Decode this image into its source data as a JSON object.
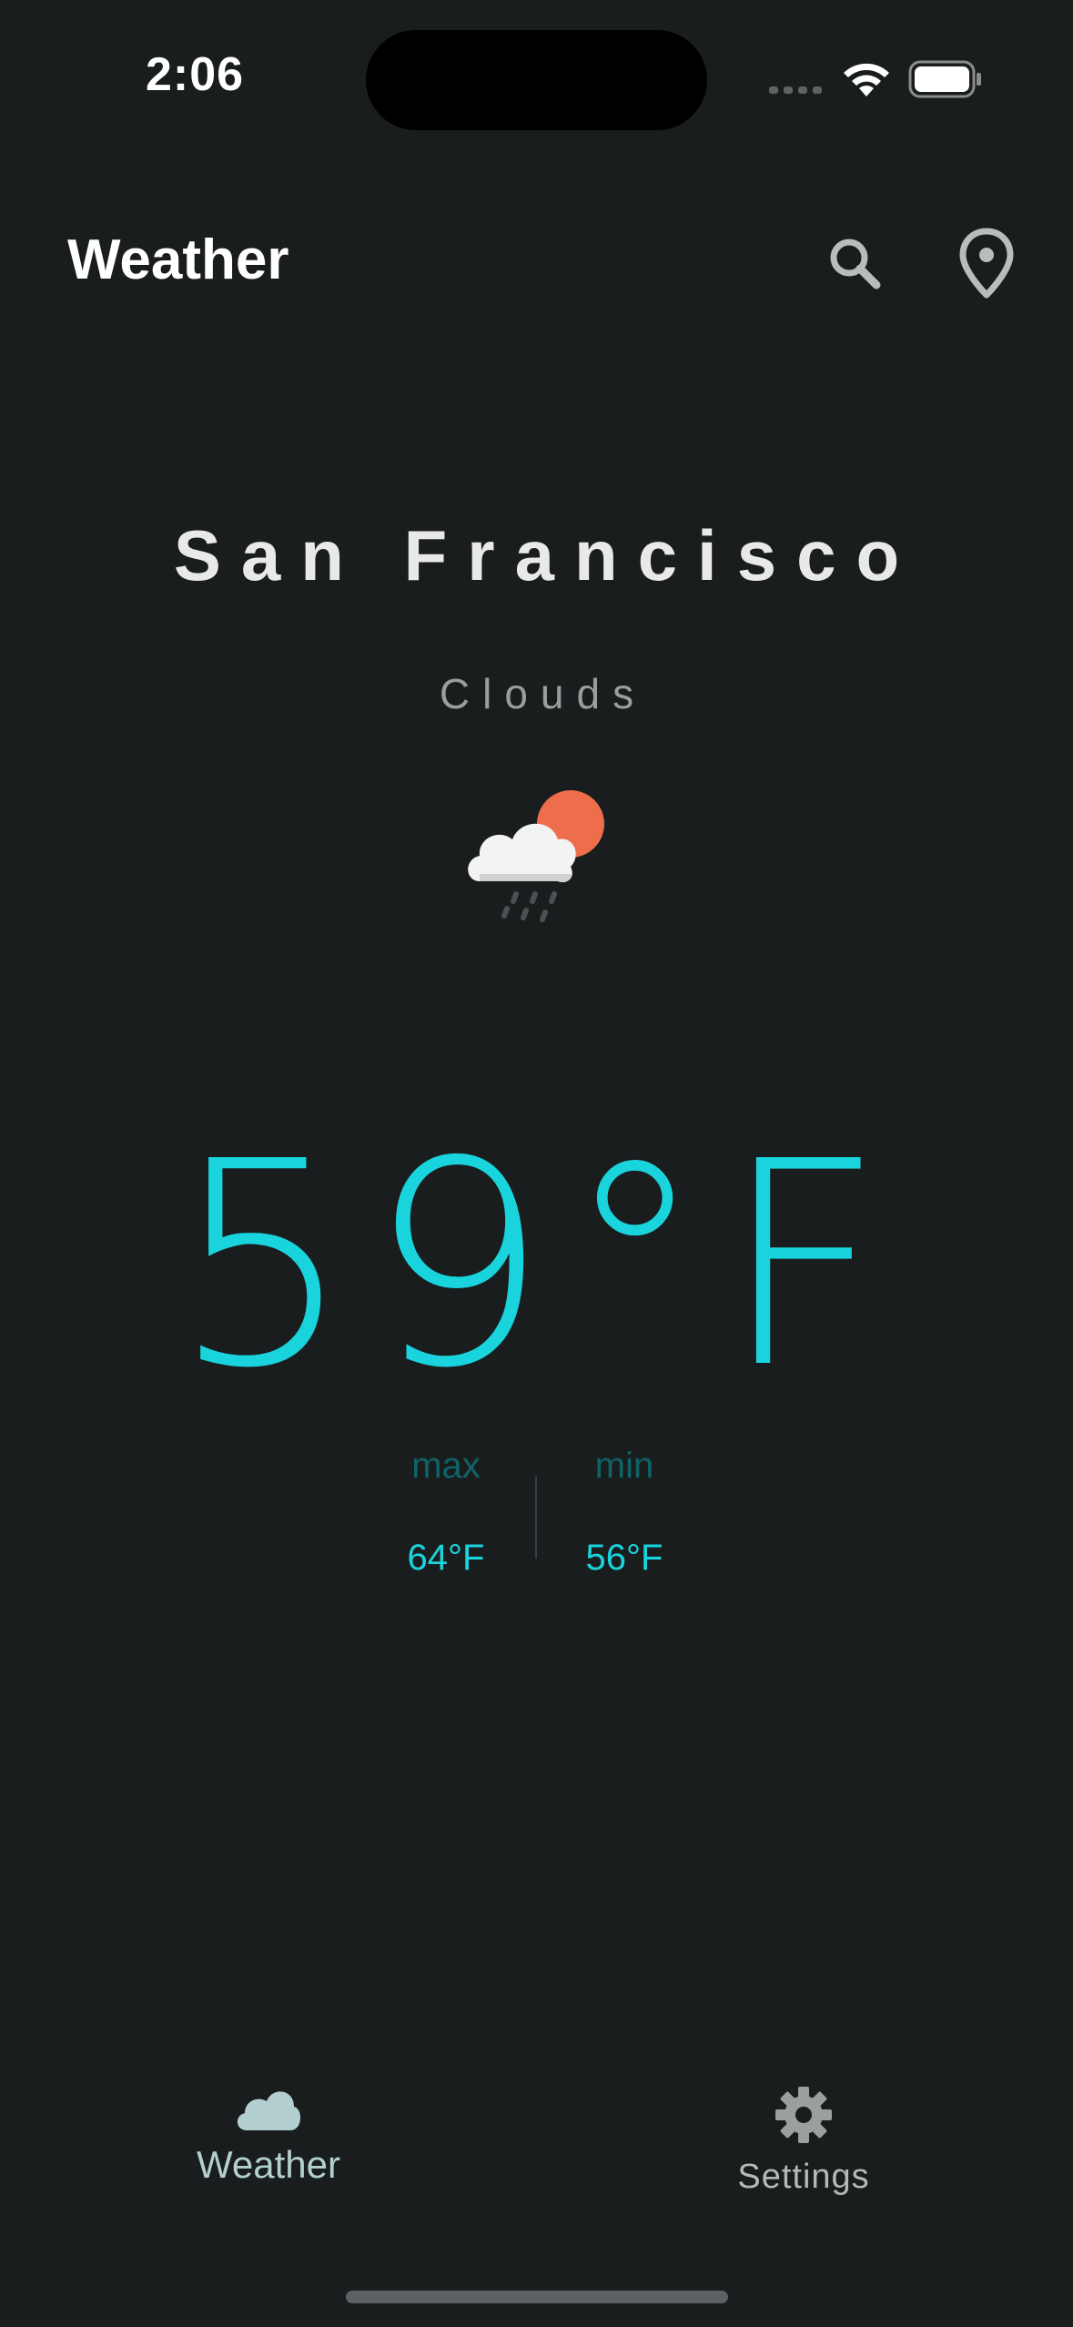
{
  "status_bar": {
    "time": "2:06",
    "icons": [
      "signal-icon",
      "wifi-icon",
      "battery-icon"
    ]
  },
  "app_bar": {
    "title": "Weather",
    "actions": [
      "search-icon",
      "location-pin-icon"
    ]
  },
  "weather": {
    "city": "San Francisco",
    "condition": "Clouds",
    "condition_icon": "cloud-sun-rain-icon",
    "temperature": "59°F",
    "max_label": "max",
    "max_value": "64°F",
    "min_label": "min",
    "min_value": "56°F"
  },
  "bottom_nav": {
    "items": [
      {
        "label": "Weather",
        "icon": "cloud-icon",
        "active": true
      },
      {
        "label": "Settings",
        "icon": "gear-icon",
        "active": false
      }
    ]
  },
  "colors": {
    "background": "#1a1d1e",
    "accent": "#19d4dd",
    "accent_dim": "#0f6366",
    "sun": "#ee6e4c"
  }
}
